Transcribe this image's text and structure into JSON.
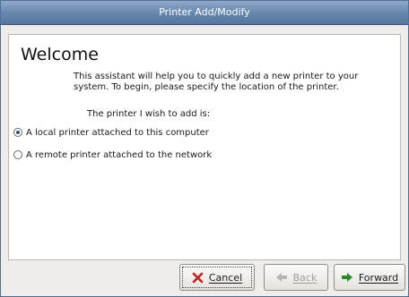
{
  "window": {
    "title": "Printer Add/Modify"
  },
  "page": {
    "heading": "Welcome",
    "intro": "This assistant will help you to quickly add a new printer to your system. To begin, please specify the location of the printer.",
    "prompt": "The printer I wish to add is:"
  },
  "options": [
    {
      "label": "A local printer attached to this computer",
      "selected": true
    },
    {
      "label": "A remote printer attached to the network",
      "selected": false
    }
  ],
  "buttons": {
    "cancel": {
      "label": "Cancel",
      "icon": "close-x-icon"
    },
    "back": {
      "label": "Back",
      "icon": "arrow-left-icon",
      "enabled": false
    },
    "forward": {
      "label": "Forward",
      "icon": "arrow-right-icon"
    }
  },
  "colors": {
    "titlebar": "#6585ad",
    "radio_selected": "#2e4f7a",
    "forward_arrow": "#2a8a2a",
    "cancel_x": "#c02020"
  }
}
